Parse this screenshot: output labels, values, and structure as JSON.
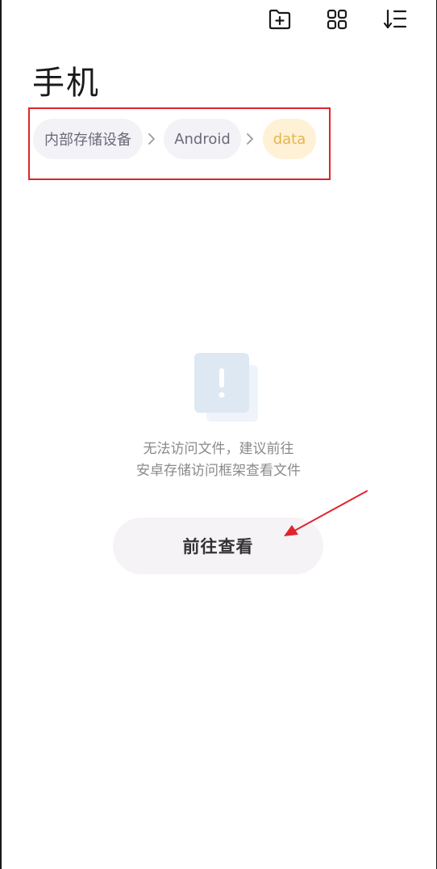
{
  "header": {
    "new_folder_icon": "folder-plus-icon",
    "grid_view_icon": "grid-view-icon",
    "sort_icon": "sort-icon"
  },
  "page": {
    "title": "手机"
  },
  "breadcrumb": {
    "items": [
      {
        "label": "内部存储设备",
        "state": "normal"
      },
      {
        "label": "Android",
        "state": "normal"
      },
      {
        "label": "data",
        "state": "active"
      }
    ]
  },
  "empty_state": {
    "icon": "warning-document-icon",
    "message_line1": "无法访问文件，建议前往",
    "message_line2": "安卓存储访问框架查看文件",
    "button_label": "前往查看"
  },
  "colors": {
    "active_crumb_bg": "#fff1d6",
    "active_crumb_text": "#e6b54a",
    "annotation_red": "#e0242a"
  }
}
